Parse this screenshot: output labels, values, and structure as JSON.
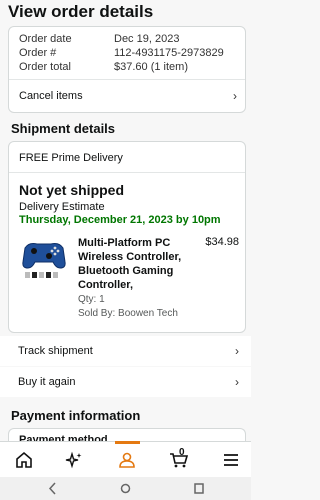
{
  "page": {
    "title": "View order details"
  },
  "order_info": {
    "rows": [
      {
        "label": "Order date",
        "value": "Dec 19, 2023"
      },
      {
        "label": "Order #",
        "value": "112-4931175-2973829"
      },
      {
        "label": "Order total",
        "value": "$37.60 (1 item)"
      }
    ],
    "cancel_label": "Cancel items"
  },
  "shipment": {
    "heading": "Shipment details",
    "method": "FREE Prime Delivery",
    "status": "Not yet shipped",
    "estimate_label": "Delivery Estimate",
    "estimate_date": "Thursday, December 21, 2023 by 10pm",
    "product": {
      "name": "Multi-Platform PC Wireless Controller, Bluetooth Gaming Controller,",
      "price": "$34.98",
      "qty": "Qty: 1",
      "seller": "Sold By: Boowen Tech"
    }
  },
  "actions": {
    "track": "Track shipment",
    "buy_again": "Buy it again"
  },
  "payment": {
    "heading": "Payment information",
    "peek": "Payment method"
  },
  "nav": {
    "icons": [
      "home-icon",
      "sparkle-icon",
      "account-icon",
      "cart-icon",
      "menu-icon"
    ],
    "cart_count": "0"
  },
  "colors": {
    "accent": "#e47911",
    "green": "#007600",
    "text": "#0f1111"
  }
}
